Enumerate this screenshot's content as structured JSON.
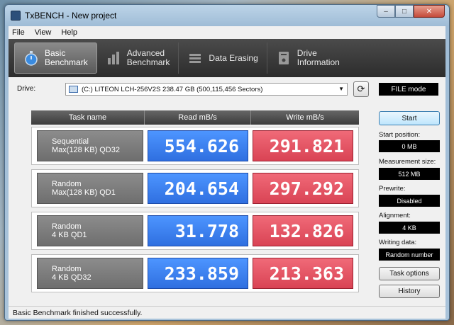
{
  "window": {
    "title": "TxBENCH - New project"
  },
  "menu": {
    "items": [
      "File",
      "View",
      "Help"
    ]
  },
  "toolbar": {
    "tabs": [
      {
        "line1": "Basic",
        "line2": "Benchmark",
        "icon": "stopwatch-icon"
      },
      {
        "line1": "Advanced",
        "line2": "Benchmark",
        "icon": "bar-chart-icon"
      },
      {
        "line1": "Data Erasing",
        "line2": "",
        "icon": "eraser-icon"
      },
      {
        "line1": "Drive",
        "line2": "Information",
        "icon": "drive-info-icon"
      }
    ],
    "active_index": 0
  },
  "drive": {
    "label": "Drive:",
    "selected": "(C:) LITEON LCH-256V2S  238.47 GB (500,115,456 Sectors)",
    "mode": "FILE mode"
  },
  "grid": {
    "headers": [
      "Task name",
      "Read mB/s",
      "Write mB/s"
    ],
    "rows": [
      {
        "task1": "Sequential",
        "task2": "Max(128 KB) QD32",
        "read": "554.626",
        "write": "291.821"
      },
      {
        "task1": "Random",
        "task2": "Max(128 KB) QD1",
        "read": "204.654",
        "write": "297.292"
      },
      {
        "task1": "Random",
        "task2": "4 KB QD1",
        "read": "31.778",
        "write": "132.826"
      },
      {
        "task1": "Random",
        "task2": "4 KB QD32",
        "read": "233.859",
        "write": "213.363"
      }
    ]
  },
  "side": {
    "start": "Start",
    "start_position_label": "Start position:",
    "start_position": "0 MB",
    "measurement_size_label": "Measurement size:",
    "measurement_size": "512 MB",
    "prewrite_label": "Prewrite:",
    "prewrite": "Disabled",
    "alignment_label": "Alignment:",
    "alignment": "4 KB",
    "writing_data_label": "Writing data:",
    "writing_data": "Random number",
    "task_options": "Task options",
    "history": "History"
  },
  "status": {
    "text": "Basic Benchmark finished successfully."
  },
  "colors": {
    "read": "#2f6fe0",
    "write": "#d94354",
    "toolbar": "#2c2c2c"
  }
}
